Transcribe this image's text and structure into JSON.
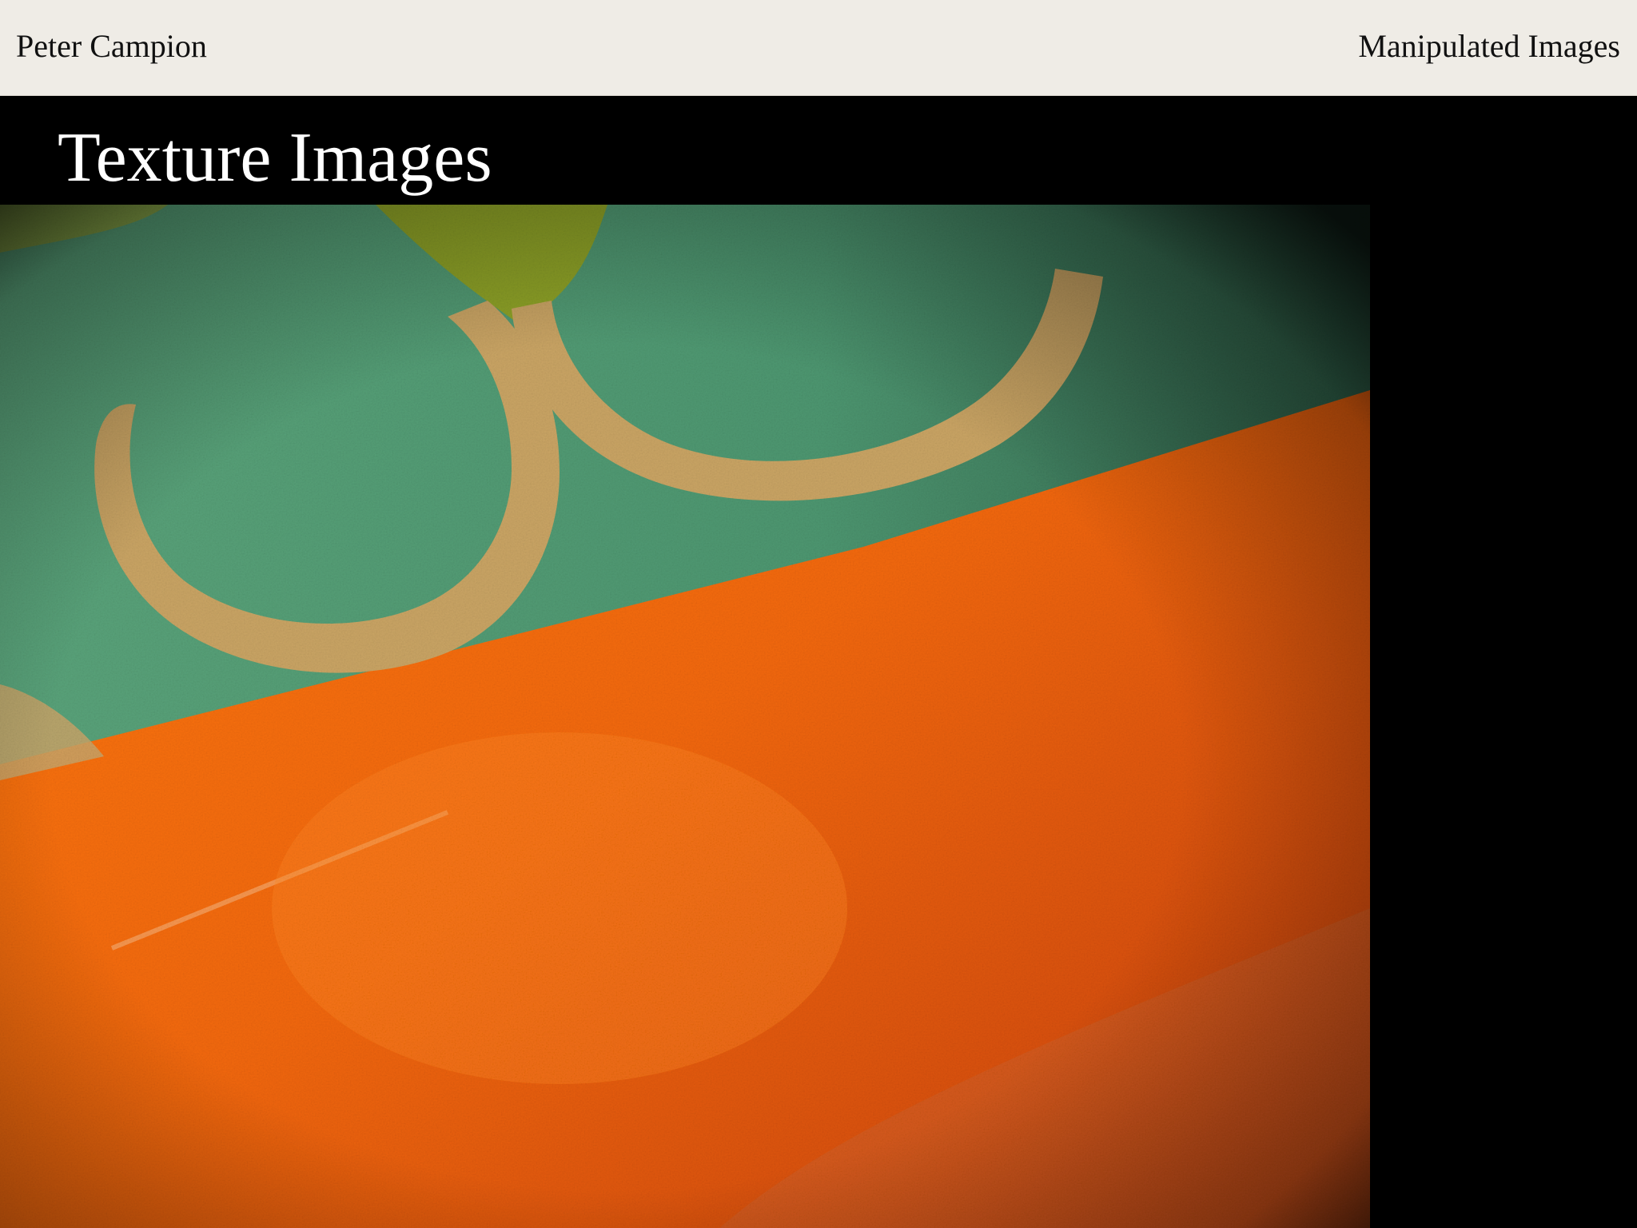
{
  "header": {
    "site_name": "Peter Campion",
    "nav_link": "Manipulated Images"
  },
  "main": {
    "title": "Texture Images"
  },
  "photo": {
    "subject": "texture-photo",
    "colors": {
      "header_bg": "#efece6",
      "page_bg": "#000000",
      "teal": "#4e9a72",
      "tan": "#c9a464",
      "lime": "#9aa51a",
      "orange": "#f26a0c"
    }
  }
}
